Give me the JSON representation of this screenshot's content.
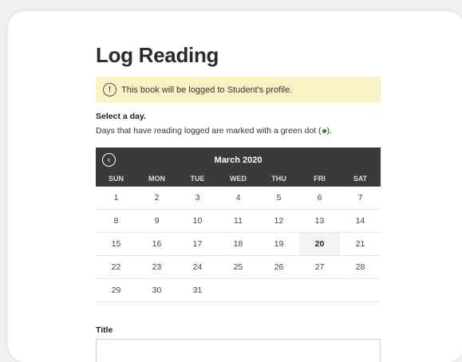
{
  "page": {
    "title": "Log Reading"
  },
  "notice": {
    "icon": "info-icon",
    "icon_glyph": "!",
    "text": "This book will be logged to Student's profile."
  },
  "instructions": {
    "select_day": "Select a day.",
    "days_note_before": "Days that have reading logged are marked with a green dot (",
    "days_note_after": ").",
    "dot_color": "#3a7d3a"
  },
  "calendar": {
    "prev_icon": "chevron-left-icon",
    "prev_glyph": "‹",
    "month": "March 2020",
    "weekdays": [
      "SUN",
      "MON",
      "TUE",
      "WED",
      "THU",
      "FRI",
      "SAT"
    ],
    "weeks": [
      [
        "1",
        "2",
        "3",
        "4",
        "5",
        "6",
        "7"
      ],
      [
        "8",
        "9",
        "10",
        "11",
        "12",
        "13",
        "14"
      ],
      [
        "15",
        "16",
        "17",
        "18",
        "19",
        "20",
        "21"
      ],
      [
        "22",
        "23",
        "24",
        "25",
        "26",
        "27",
        "28"
      ],
      [
        "29",
        "30",
        "31",
        "",
        "",
        "",
        ""
      ]
    ],
    "today": "20",
    "header_color": "#3a3a3a"
  },
  "form": {
    "title_label": "Title",
    "title_value": ""
  },
  "colors": {
    "notice_bg": "#faf2c4"
  }
}
